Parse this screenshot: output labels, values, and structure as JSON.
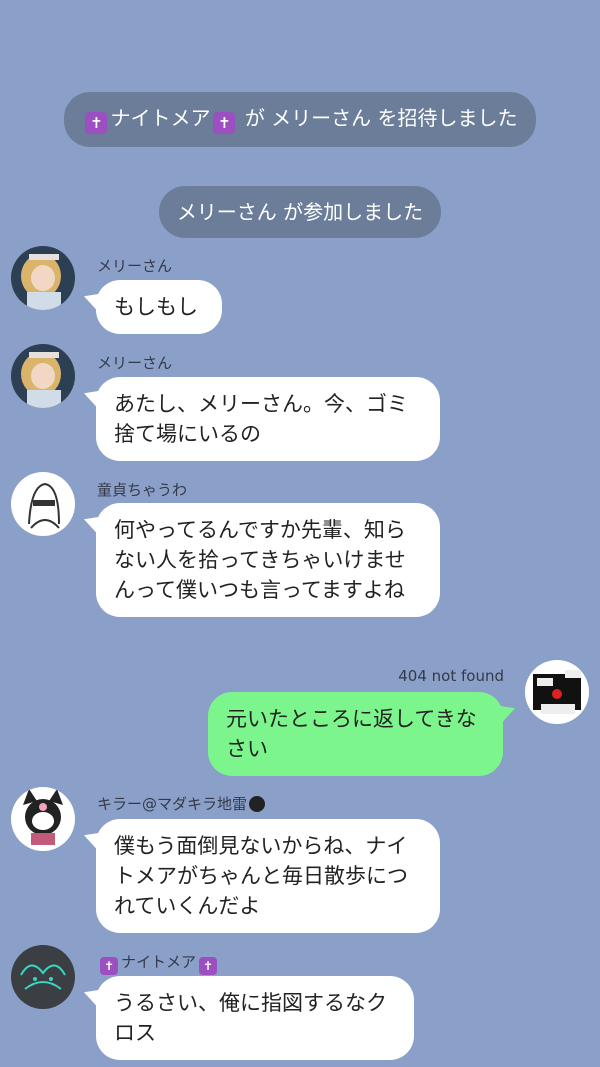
{
  "system": {
    "invite": {
      "inviter": "ナイトメア",
      "connector": "が",
      "invitee": "メリーさん",
      "action": "を招待しました"
    },
    "joined": {
      "user": "メリーさん",
      "action": "が参加しました"
    }
  },
  "messages": [
    {
      "sender": "メリーさん",
      "text": "もしもし"
    },
    {
      "sender": "メリーさん",
      "text": "あたし、メリーさん。今、ゴミ捨て場にいるの"
    },
    {
      "sender": "童貞ちゃうわ",
      "text": "何やってるんですか先輩、知らない人を拾ってきちゃいけませんって僕いつも言ってますよね"
    },
    {
      "sender": "404 not found",
      "text": "元いたところに返してきなさい"
    },
    {
      "sender": "キラー@マダキラ地雷",
      "text": "僕もう面倒見ないからね、ナイトメアがちゃんと毎日散歩につれていくんだよ"
    },
    {
      "sender": "ナイトメア",
      "text": "うるさい、俺に指図するなクロス"
    }
  ],
  "icons": {
    "cross": "latin-cross-icon",
    "bomb": "bomb-icon"
  },
  "colors": {
    "background": "#8aa0c8",
    "system_pill": "#6c7d99",
    "incoming_bubble": "#ffffff",
    "outgoing_bubble": "#7cf58c",
    "cross_badge": "#9b4fc0"
  }
}
